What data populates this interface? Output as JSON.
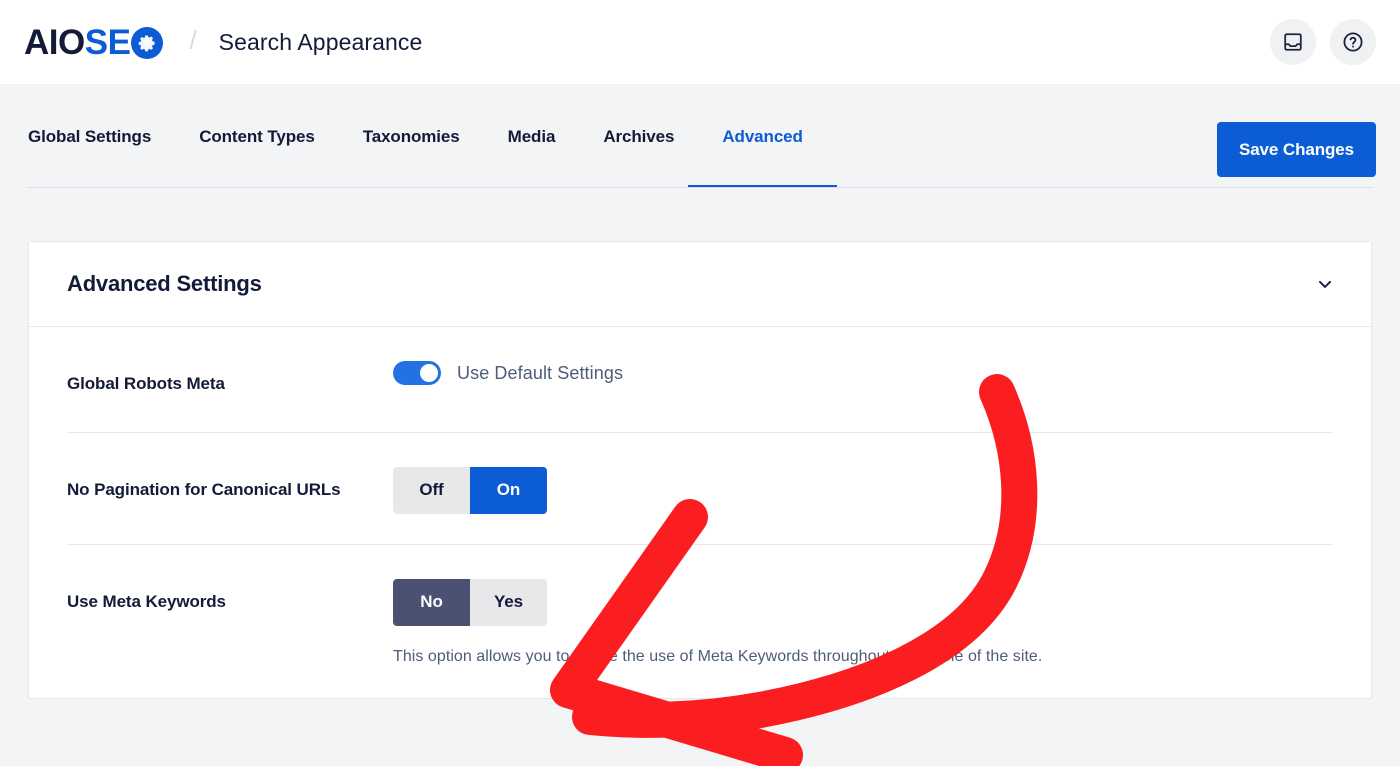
{
  "header": {
    "logo_aio": "AIO",
    "logo_se": "SE",
    "logo_gear_icon": "gear-icon",
    "separator": "/",
    "page_title": "Search Appearance",
    "actions": [
      {
        "name": "inbox-icon",
        "label": "Notifications"
      },
      {
        "name": "help-icon",
        "label": "Help"
      }
    ]
  },
  "tabs": [
    {
      "label": "Global Settings",
      "active": false
    },
    {
      "label": "Content Types",
      "active": false
    },
    {
      "label": "Taxonomies",
      "active": false
    },
    {
      "label": "Media",
      "active": false
    },
    {
      "label": "Archives",
      "active": false
    },
    {
      "label": "Advanced",
      "active": true
    }
  ],
  "toolbar": {
    "save_label": "Save Changes"
  },
  "card": {
    "title": "Advanced Settings",
    "collapse_icon": "chevron-down-icon",
    "rows": [
      {
        "label": "Global Robots Meta",
        "control": "toggle",
        "toggle_on": true,
        "toggle_label": "Use Default Settings"
      },
      {
        "label": "No Pagination for Canonical URLs",
        "control": "segmented",
        "options": [
          "Off",
          "On"
        ],
        "selected": "On"
      },
      {
        "label": "Use Meta Keywords",
        "control": "segmented",
        "options": [
          "No",
          "Yes"
        ],
        "selected": "No",
        "description": "This option allows you to toggle the use of Meta Keywords throughout the whole of the site."
      }
    ]
  },
  "annotation": {
    "type": "curved-arrow",
    "color": "#FA1E20",
    "points_to": "use-meta-keywords-toggle",
    "direction": "left"
  },
  "colors": {
    "accent_blue": "#0B5CD5",
    "toggle_blue": "#2272E4",
    "dark_navy": "#141B38",
    "slate": "#4A5173",
    "page_bg": "#F3F4F5",
    "annotation_red": "#FA1E20"
  }
}
